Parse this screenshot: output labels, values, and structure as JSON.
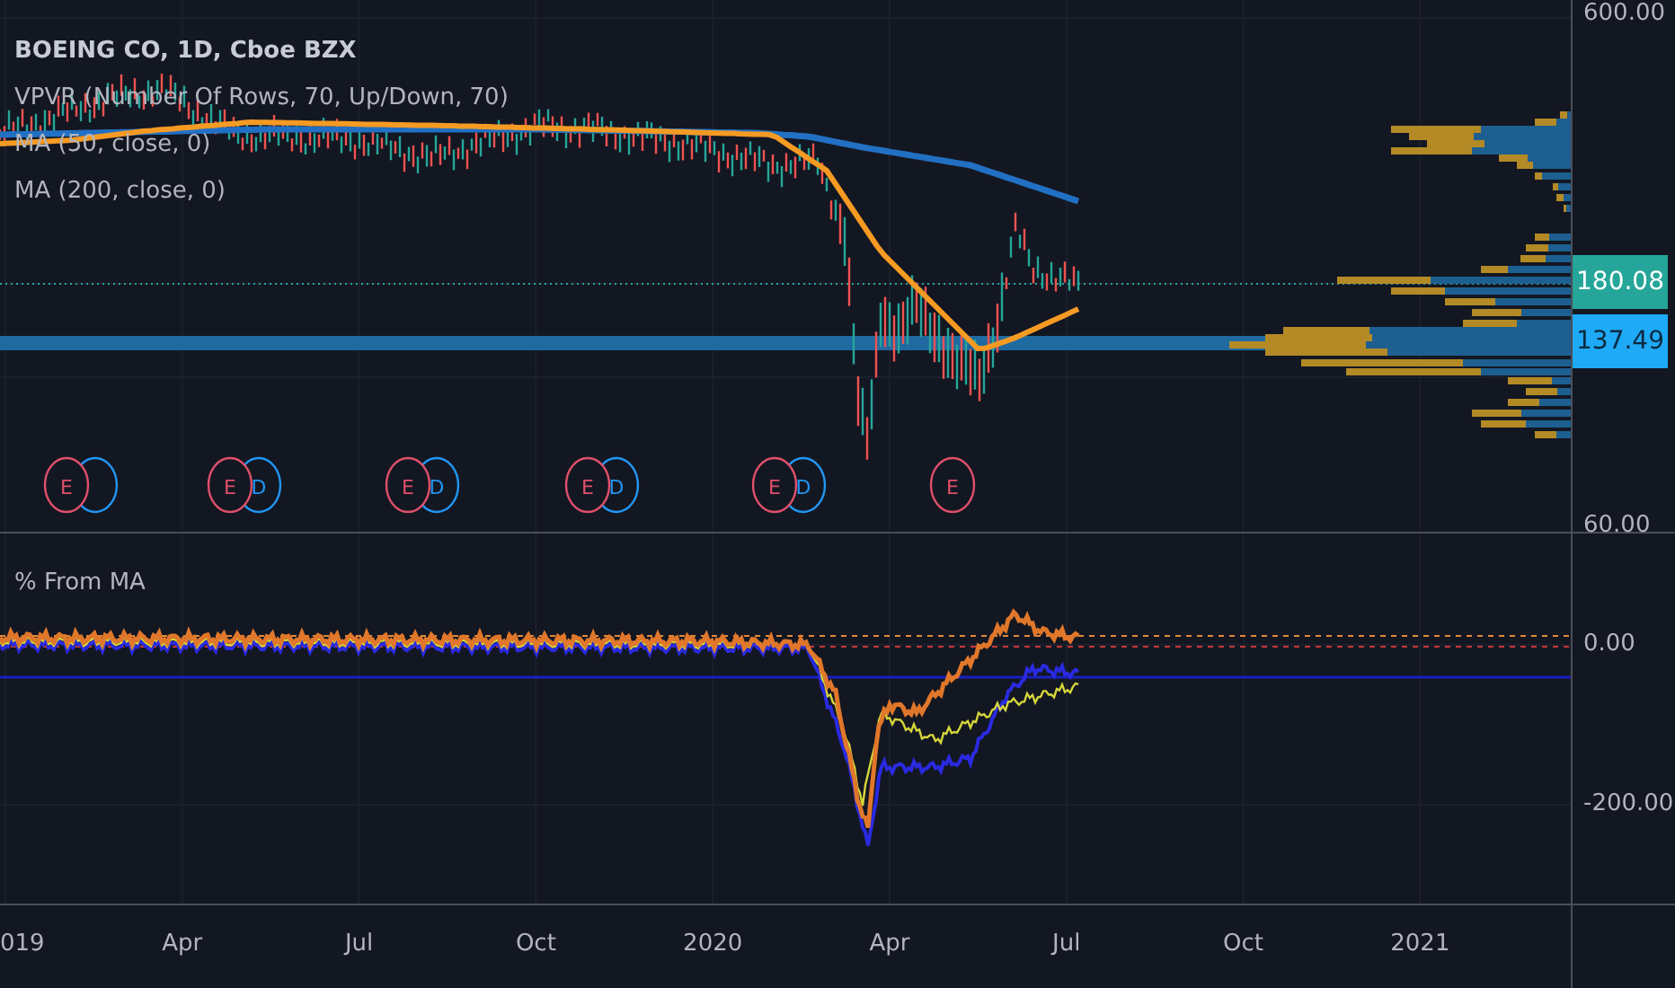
{
  "main_pane": {
    "title": "BOEING CO, 1D, Cboe BZX",
    "indicators": [
      "VPVR (Number Of Rows, 70, Up/Down, 70)",
      "MA (50, close, 0)",
      "MA (200, close, 0)"
    ],
    "price_axis": [
      "600.00",
      "60.00"
    ],
    "price_labels": [
      {
        "value": "180.08",
        "kind": "last"
      },
      {
        "value": "137.49",
        "kind": "poc"
      }
    ],
    "events": [
      {
        "label": "E",
        "dividend": true
      },
      {
        "label": "E",
        "dividend": true,
        "dividend_label": "D"
      },
      {
        "label": "E",
        "dividend": true,
        "dividend_label": "D"
      },
      {
        "label": "E",
        "dividend": true,
        "dividend_label": "D"
      },
      {
        "label": "E",
        "dividend": true,
        "dividend_label": "D"
      },
      {
        "label": "E",
        "dividend": false
      }
    ]
  },
  "sub_pane": {
    "title": "% From MA",
    "value_axis": [
      "0.00",
      "-200.00"
    ]
  },
  "time_axis": [
    "019",
    "Apr",
    "Jul",
    "Oct",
    "2020",
    "Apr",
    "Jul",
    "Oct",
    "2021"
  ]
}
